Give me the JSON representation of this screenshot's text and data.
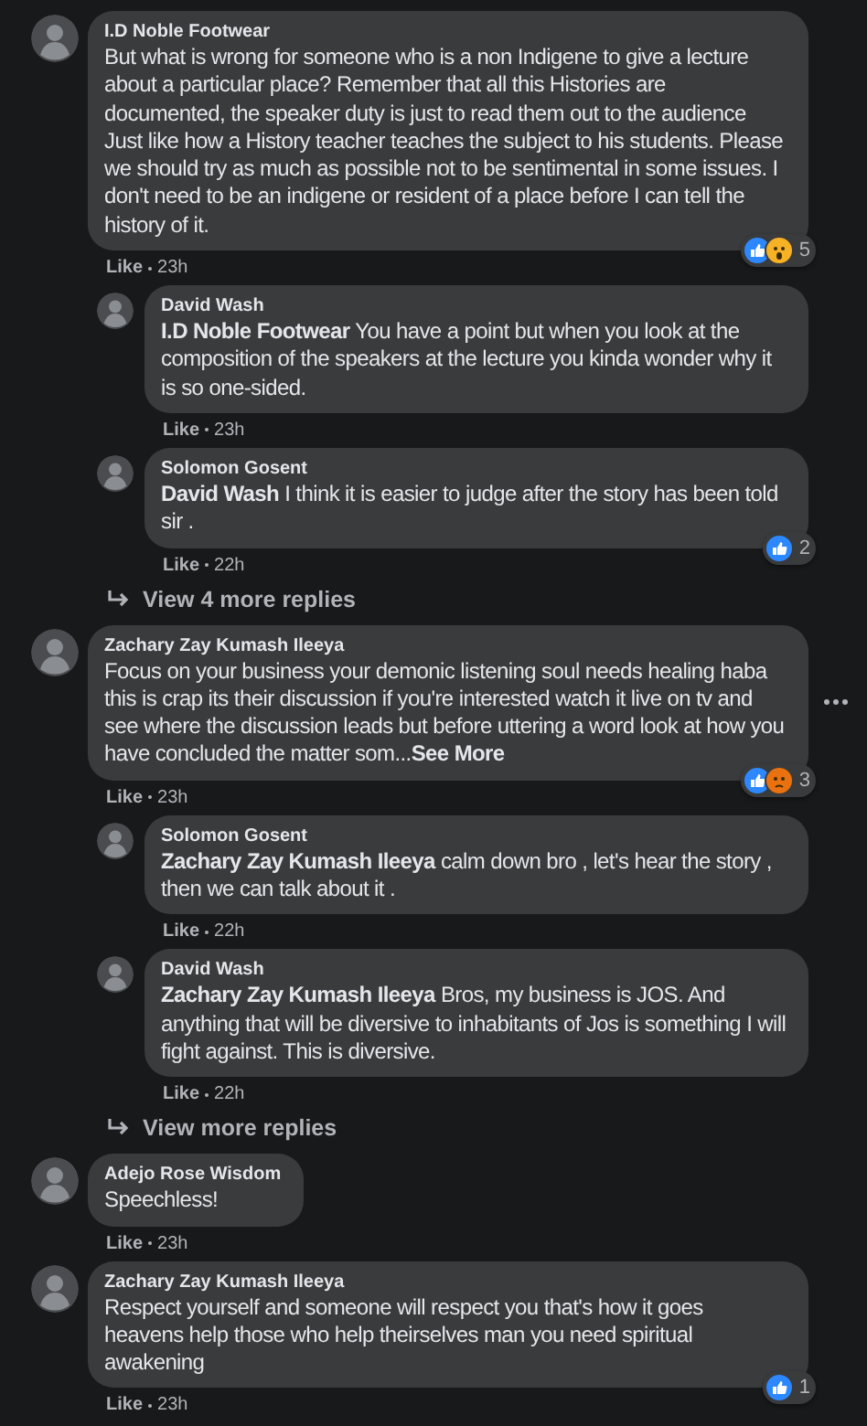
{
  "thread": [
    {
      "kind": "comment",
      "author": "I.D Noble Footwear",
      "text": "But what is wrong for someone who is a non Indigene to give a lecture about a particular place? Remember that all this Histories are documented, the speaker duty is just to read them out to the audience Just like how a History teacher teaches the subject to his students. Please we should try as much as possible not to be sentimental in some issues. I don't need to be an indigene or resident of a place before I can tell the history of it.",
      "like": "Like",
      "time": "23h",
      "reactions": [
        {
          "kind": "like"
        },
        {
          "kind": "wow"
        }
      ],
      "count": "5"
    },
    {
      "kind": "reply",
      "author": "David Wash",
      "text": "**I.D Noble Footwear** You have a point but when you look at the composition of the speakers at the lecture you kinda wonder why it is so one-sided.",
      "like": "Like",
      "time": "23h"
    },
    {
      "kind": "reply",
      "author": "Solomon Gosent",
      "text": "**David Wash** I think it is easier to judge after the story has been told sir .",
      "like": "Like",
      "time": "22h",
      "reactions": [
        {
          "kind": "like"
        }
      ],
      "count": "2"
    },
    {
      "kind": "more",
      "text": "View 4 more replies"
    },
    {
      "kind": "comment",
      "author": "Zachary Zay Kumash Ileeya",
      "text": "Focus on your business your demonic listening soul needs healing haba this is crap its their discussion if you're interested watch it live on tv and see where the discussion leads but before uttering a word look at how you have concluded the matter som...",
      "see_more": "See More",
      "menu": true,
      "like": "Like",
      "time": "23h",
      "reactions": [
        {
          "kind": "like"
        },
        {
          "kind": "angry"
        }
      ],
      "count": "3"
    },
    {
      "kind": "reply",
      "author": "Solomon Gosent",
      "text": "**Zachary Zay Kumash Ileeya** calm down bro , let's hear the story , then we can talk about it .",
      "like": "Like",
      "time": "22h"
    },
    {
      "kind": "reply",
      "author": "David Wash",
      "text": "**Zachary Zay Kumash Ileeya** Bros, my business is JOS. And anything that will be diversive to inhabitants of Jos is something I will fight against. This is diversive.",
      "like": "Like",
      "time": "22h"
    },
    {
      "kind": "more",
      "text": "View more replies"
    },
    {
      "kind": "comment",
      "author": "Adejo Rose Wisdom",
      "text": "Speechless!",
      "like": "Like",
      "time": "23h"
    },
    {
      "kind": "comment",
      "author": "Zachary Zay Kumash Ileeya",
      "text": "Respect yourself and someone will respect you that's how it goes heavens help those who help theirselves man you need spiritual awakening",
      "like": "Like",
      "time": "23h",
      "reactions": [
        {
          "kind": "like"
        }
      ],
      "count": "1"
    }
  ]
}
